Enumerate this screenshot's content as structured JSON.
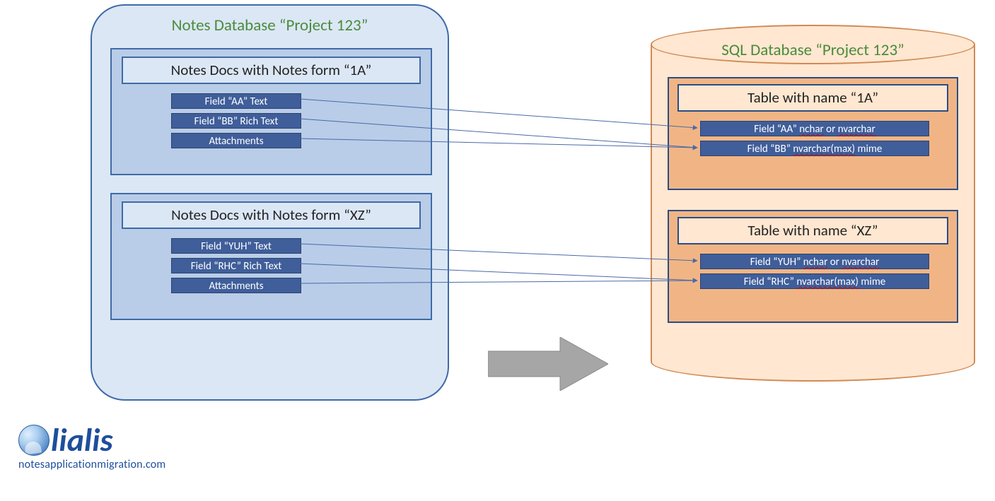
{
  "left": {
    "title": "Notes Database “Project 123”",
    "panels": [
      {
        "heading": "Notes Docs with Notes form “1A”",
        "fields": [
          "Field “AA” Text",
          "Field “BB” Rich Text",
          "Attachments"
        ]
      },
      {
        "heading": "Notes Docs with Notes form “XZ”",
        "fields": [
          "Field “YUH” Text",
          "Field “RHC” Rich Text",
          "Attachments"
        ]
      }
    ]
  },
  "right": {
    "title": "SQL Database “Project 123”",
    "tables": [
      {
        "heading": "Table with name “1A”",
        "fields_html": [
          "Field “AA” <span class='squiggle'>nchar</span> or <span class='squiggle'>nvarchar</span>",
          "Field “BB” <span class='squiggle'>nvarchar(max)</span> mime"
        ],
        "fields": [
          "Field “AA” nchar or nvarchar",
          "Field “BB” nvarchar(max) mime"
        ]
      },
      {
        "heading": "Table with name “XZ”",
        "fields_html": [
          "Field “YUH” <span class='squiggle'>nchar</span> or <span class='squiggle'>nvarchar</span>",
          "Field “RHC” <span class='squiggle'>nvarchar(max)</span> mime"
        ],
        "fields": [
          "Field “YUH” nchar or nvarchar",
          "Field “RHC” nvarchar(max) mime"
        ]
      }
    ]
  },
  "logo": {
    "brand": "lialis",
    "subtitle": "notesapplicationmigration.com"
  },
  "colors": {
    "notes_bg": "#dbe7f5",
    "notes_border": "#3f6aa6",
    "field_bg": "#3f5e9a",
    "sql_bg": "#ffe7d1",
    "sql_border": "#d08a55",
    "title_green": "#4b8b3b",
    "logo_blue": "#1e4e9c"
  },
  "mapping": [
    {
      "from": "1A.AA",
      "to": "1A.AA"
    },
    {
      "from": "1A.BB",
      "to": "1A.BB"
    },
    {
      "from": "1A.Attachments",
      "to": "1A.BB"
    },
    {
      "from": "XZ.YUH",
      "to": "XZ.YUH"
    },
    {
      "from": "XZ.RHC",
      "to": "XZ.RHC"
    },
    {
      "from": "XZ.Attachments",
      "to": "XZ.RHC"
    }
  ]
}
